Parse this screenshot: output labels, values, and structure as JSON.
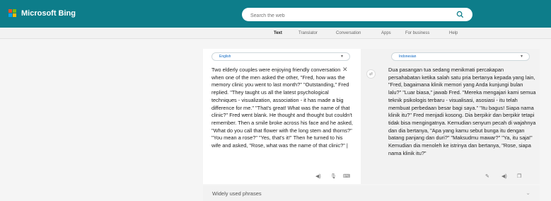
{
  "header": {
    "brand": "Microsoft Bing",
    "logo_colors": [
      "#f25022",
      "#7fba00",
      "#00a4ef",
      "#ffb900"
    ],
    "search_placeholder": "Search the web",
    "accent": "#0d7d8a"
  },
  "nav": {
    "items": [
      "Text",
      "Translator",
      "Conversation",
      "Apps",
      "For business",
      "Help"
    ]
  },
  "source": {
    "language": "English",
    "text": "Two elderly couples were enjoying friendly conversation when one of the men asked the other, \"Fred, how was the memory clinic you went to last month?\" \"Outstanding,\" Fred replied. \"They taught us all the latest psychological techniques - visualization, association - it has made a big difference for me.\" \"That's great! What was the name of that clinic?\" Fred went blank. He thought and thought but couldn't remember. Then a smile broke across his face and he asked, \"What do you call that flower with the long stem and thorns?\" \"You mean a rose?\" \"Yes, that's it!\" Then he turned to his wife and asked, \"Rose, what was the name of that clinic?\" |",
    "icons": [
      "clear-icon",
      "speaker-icon",
      "microphone-icon",
      "keyboard-icon"
    ]
  },
  "target": {
    "language": "Indonesian",
    "text": "Dua pasangan tua sedang menikmati percakapan persahabatan ketika salah satu pria bertanya kepada yang lain, \"Fred, bagaimana klinik memori yang Anda kunjungi bulan lalu?\" \"Luar biasa,\" jawab Fred. \"Mereka mengajari kami semua teknik psikologis terbaru - visualisasi, asosiasi - itu telah membuat perbedaan besar bagi saya.\" \"Itu bagus! Siapa nama klinik itu?\" Fred menjadi kosong. Dia berpikir dan berpikir tetapi tidak bisa mengingatnya. Kemudian senyum pecah di wajahnya dan dia bertanya, \"Apa yang kamu sebut bunga itu dengan batang panjang dan duri?\" \"Maksudmu mawar?\" \"Ya, itu saja!\" Kemudian dia menoleh ke istrinya dan bertanya, \"Rose, siapa nama klinik itu?\"",
    "icons": [
      "edit-icon",
      "speaker-icon",
      "copy-icon"
    ]
  },
  "phrases": {
    "label": "Widely used phrases"
  }
}
